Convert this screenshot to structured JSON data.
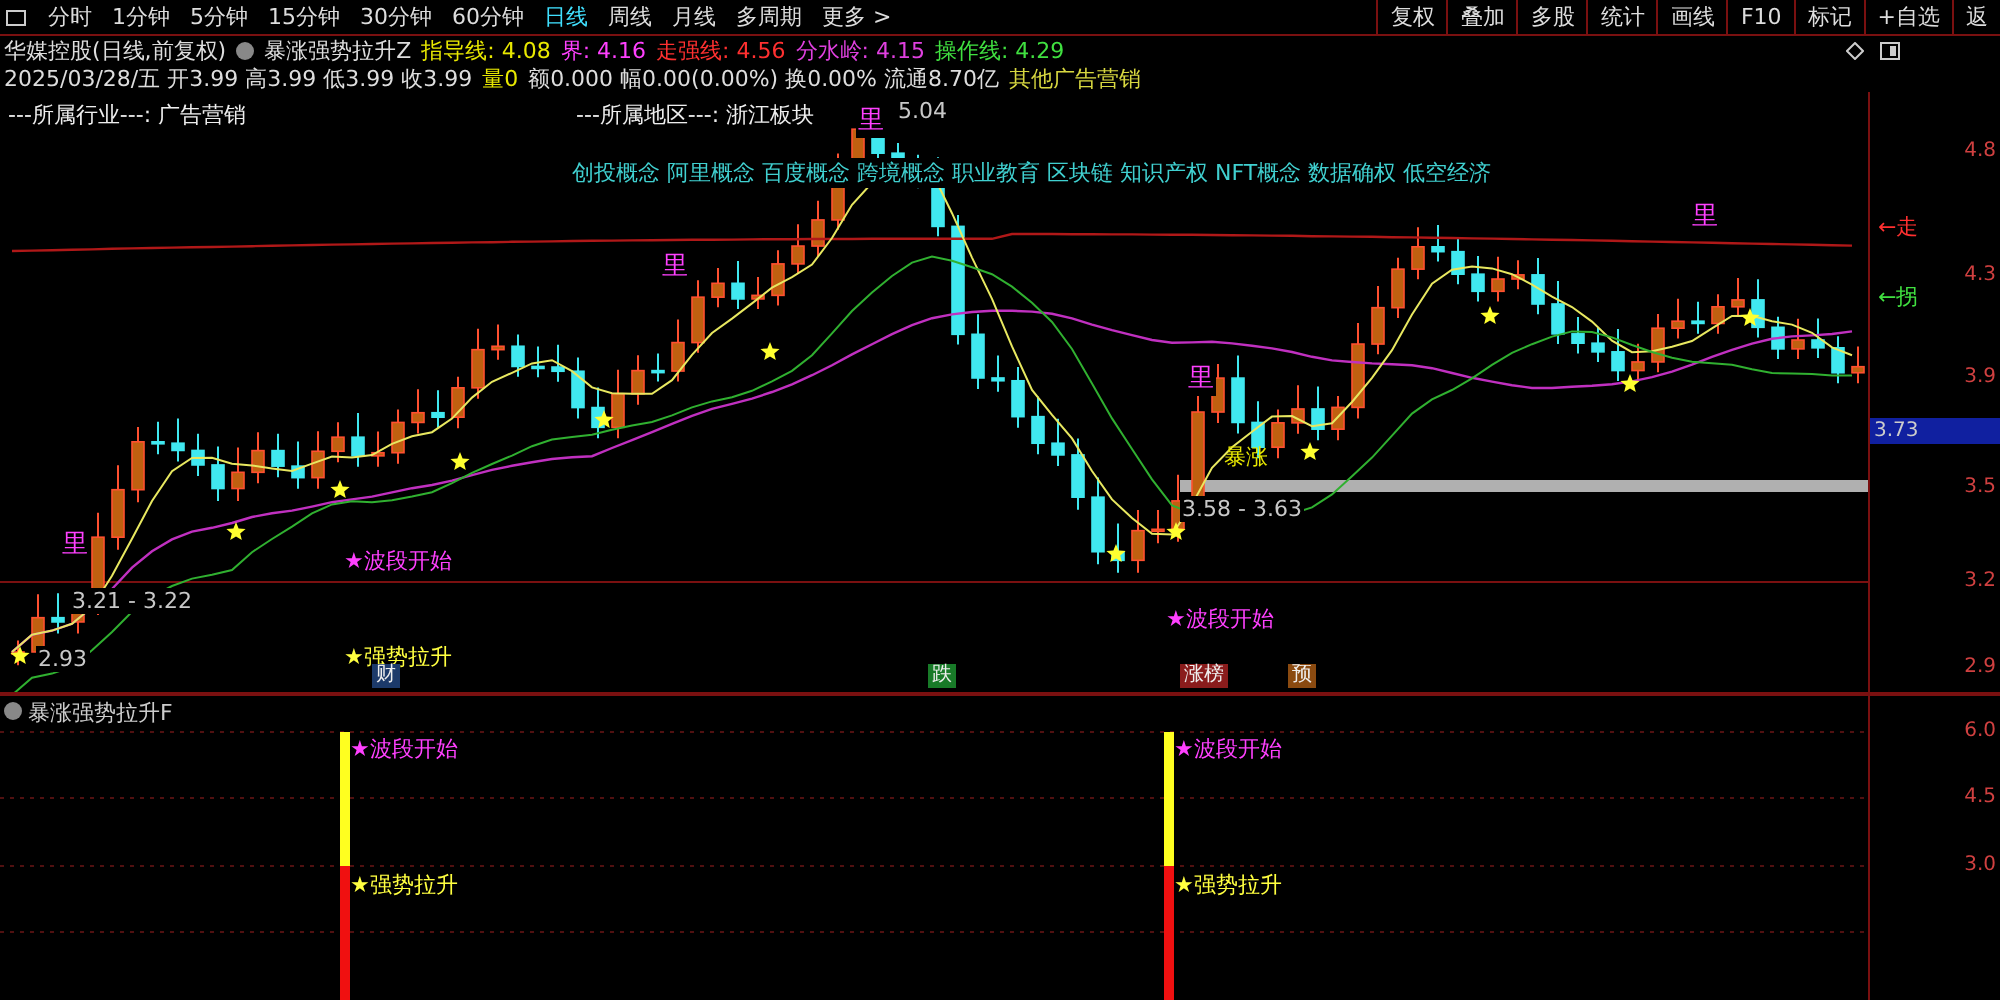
{
  "toolbar": {
    "periods": [
      {
        "label": "分时",
        "selected": false
      },
      {
        "label": "1分钟",
        "selected": false
      },
      {
        "label": "5分钟",
        "selected": false
      },
      {
        "label": "15分钟",
        "selected": false
      },
      {
        "label": "30分钟",
        "selected": false
      },
      {
        "label": "60分钟",
        "selected": false
      },
      {
        "label": "日线",
        "selected": true
      },
      {
        "label": "周线",
        "selected": false
      },
      {
        "label": "月线",
        "selected": false
      },
      {
        "label": "多周期",
        "selected": false
      },
      {
        "label": "更多 >",
        "selected": false
      }
    ],
    "buttons": [
      "复权",
      "叠加",
      "多股",
      "统计",
      "画线",
      "F10",
      "标记",
      "+自选",
      "返"
    ]
  },
  "info": {
    "title": "华媒控股(日线,前复权)",
    "indicator": "暴涨强势拉升Z",
    "values": [
      {
        "label": "指导线: 4.08",
        "color": "#e8e800"
      },
      {
        "label": "界: 4.16",
        "color": "#ff40ff"
      },
      {
        "label": "走强线: 4.56",
        "color": "#ff3030"
      },
      {
        "label": "分水岭: 4.15",
        "color": "#e040e0"
      },
      {
        "label": "操作线: 4.29",
        "color": "#40e040"
      }
    ]
  },
  "quote": {
    "prices": "2025/03/28/五 开3.99 高3.99 低3.99 收3.99",
    "volume": "量0",
    "details": "额0.000 幅0.00(0.00%) 换0.00% 流通8.70亿",
    "sector": "其他广告营销"
  },
  "chart": {
    "industry": "---所属行业---: 广告营销",
    "region": "---所属地区---: 浙江板块",
    "concepts": "创投概念 阿里概念 百度概念 跨境概念 职业教育 区块链 知识产权 NFT概念 数据确权 低空经济",
    "annotations": [
      {
        "kind": "mark",
        "text": "里",
        "color": "#ff40ff"
      },
      {
        "kind": "mark",
        "text": "里",
        "color": "#ff40ff"
      },
      {
        "kind": "mark",
        "text": "里",
        "color": "#ff40ff"
      },
      {
        "kind": "mark",
        "text": "里",
        "color": "#ff40ff"
      },
      {
        "kind": "mark",
        "text": "里",
        "color": "#ff40ff"
      },
      {
        "kind": "price",
        "text": "5.04",
        "color": "#c8c8c8"
      },
      {
        "kind": "price",
        "text": "3.58 - 3.63",
        "color": "#c8c8c8"
      },
      {
        "kind": "price",
        "text": "3.21 - 3.22",
        "color": "#c8c8c8"
      },
      {
        "kind": "price",
        "text": "2.93",
        "color": "#c8c8c8"
      },
      {
        "kind": "line_tag",
        "text": "←走",
        "color": "#ff3030"
      },
      {
        "kind": "line_tag",
        "text": "←拐",
        "color": "#40e040"
      },
      {
        "kind": "label",
        "text": "暴涨",
        "color": "#e8e800"
      },
      {
        "kind": "signal",
        "text": "★波段开始",
        "color": "#ff40ff"
      },
      {
        "kind": "signal",
        "text": "★波段开始",
        "color": "#ff40ff"
      },
      {
        "kind": "signal",
        "text": "★强势拉升",
        "color": "#ffff40"
      },
      {
        "kind": "badge",
        "text": "财",
        "color": "#1c3a6a"
      },
      {
        "kind": "badge",
        "text": "跌",
        "color": "#187a28"
      },
      {
        "kind": "badge",
        "text": "涨榜",
        "color": "#8a1c1c"
      },
      {
        "kind": "badge",
        "text": "预",
        "color": "#8a4a10"
      }
    ],
    "axis": [
      "4.8",
      "4.3",
      "3.9",
      "3.5",
      "3.2",
      "2.9"
    ],
    "current_price": "3.73"
  },
  "lower_pane": {
    "title": "暴涨强势拉升F",
    "signals": [
      {
        "text": "★波段开始",
        "color": "#ff40ff"
      },
      {
        "text": "★波段开始",
        "color": "#ff40ff"
      },
      {
        "text": "★强势拉升",
        "color": "#ffff40"
      },
      {
        "text": "★强势拉升",
        "color": "#ffff40"
      }
    ],
    "axis": [
      "6.0",
      "4.5",
      "3.0"
    ]
  }
}
